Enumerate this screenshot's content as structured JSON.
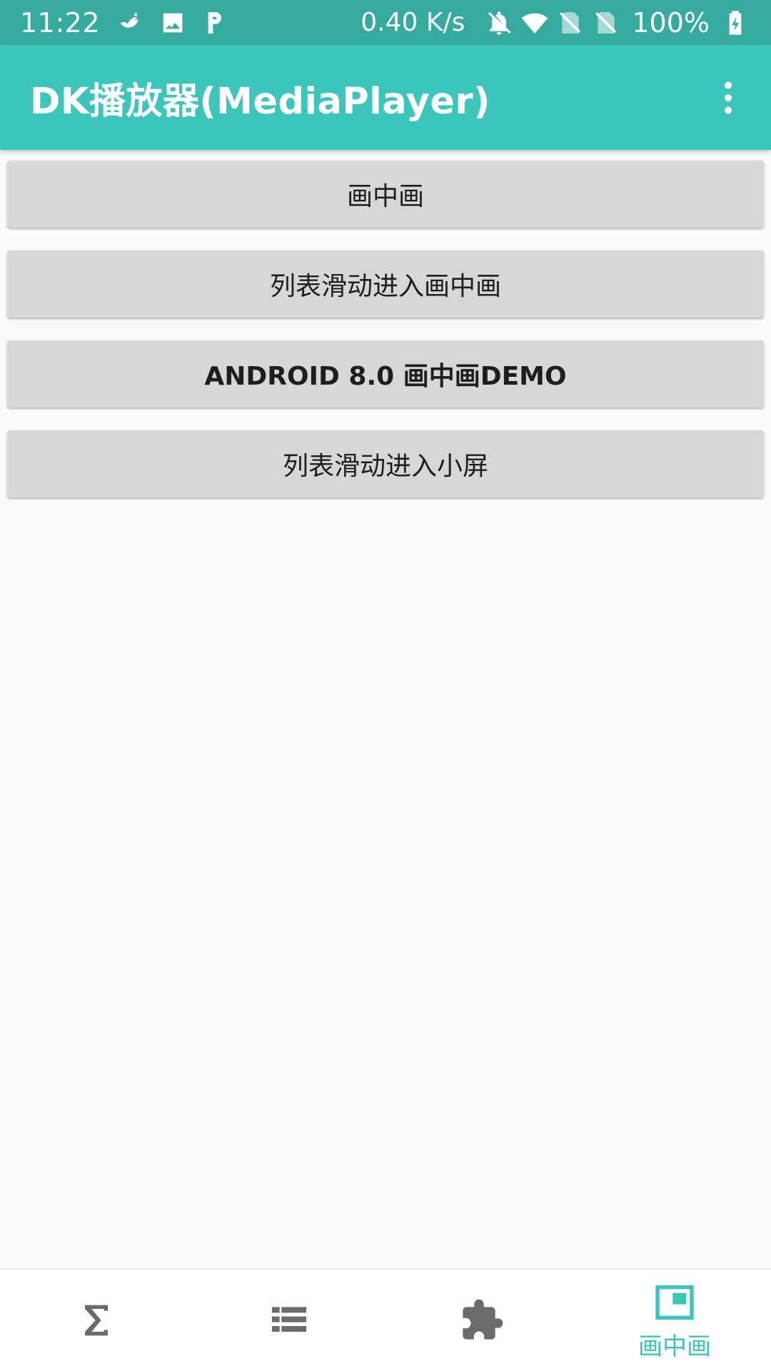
{
  "status_bar": {
    "time": "11:22",
    "net_rate": "0.40 K/s",
    "battery": "100%",
    "icons": [
      "bird-notification-icon",
      "image-notification-icon",
      "p-notification-icon",
      "bell-off-icon",
      "wifi-icon",
      "no-sim-icon",
      "no-sim-icon",
      "battery-charging-icon"
    ]
  },
  "app_bar": {
    "title": "DK播放器(MediaPlayer)",
    "overflow_icon": "more-vert-icon"
  },
  "buttons": [
    {
      "label": "画中画"
    },
    {
      "label": "列表滑动进入画中画"
    },
    {
      "label": "ANDROID 8.0 画中画DEMO"
    },
    {
      "label": "列表滑动进入小屏"
    }
  ],
  "bottom_nav": {
    "items": [
      {
        "icon": "sigma-icon",
        "label": ""
      },
      {
        "icon": "list-icon",
        "label": ""
      },
      {
        "icon": "puzzle-icon",
        "label": ""
      },
      {
        "icon": "picture-in-picture-icon",
        "label": "画中画",
        "selected": true
      }
    ],
    "active_color": "#3cc6bb",
    "inactive_color": "#6b6b6b"
  },
  "colors": {
    "status_bar": "#35aba0",
    "app_bar": "#3cc6bb",
    "button_bg": "#d6d7d7",
    "page_bg": "#fafafa"
  }
}
